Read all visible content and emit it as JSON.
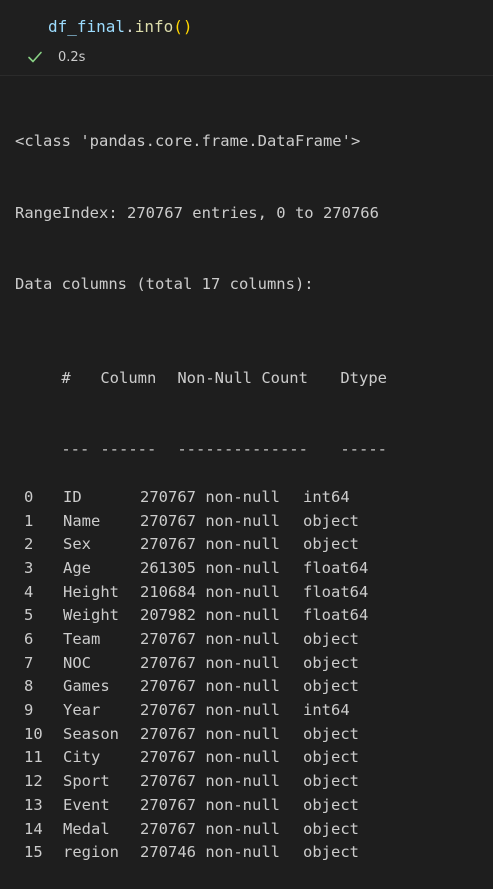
{
  "cell": {
    "code": {
      "variable": "df_final",
      "dot": ".",
      "method": "info",
      "parens": "()"
    },
    "status": {
      "icon": "check-icon",
      "time": "0.2s",
      "success_color": "#89d185"
    }
  },
  "output": {
    "class_line": "<class 'pandas.core.frame.DataFrame'>",
    "range_index": "RangeIndex: 270767 entries, 0 to 270766",
    "data_columns": "Data columns (total 17 columns):",
    "headers": {
      "num": "#",
      "column": "Column",
      "count": "Non-Null Count",
      "dtype": "Dtype"
    },
    "separators": {
      "num": "---",
      "column": "------",
      "count": "--------------",
      "dtype": "-----"
    },
    "rows": [
      {
        "num": "0",
        "column": "ID",
        "count": "270767 non-null",
        "dtype": "int64"
      },
      {
        "num": "1",
        "column": "Name",
        "count": "270767 non-null",
        "dtype": "object"
      },
      {
        "num": "2",
        "column": "Sex",
        "count": "270767 non-null",
        "dtype": "object"
      },
      {
        "num": "3",
        "column": "Age",
        "count": "261305 non-null",
        "dtype": "float64"
      },
      {
        "num": "4",
        "column": "Height",
        "count": "210684 non-null",
        "dtype": "float64"
      },
      {
        "num": "5",
        "column": "Weight",
        "count": "207982 non-null",
        "dtype": "float64"
      },
      {
        "num": "6",
        "column": "Team",
        "count": "270767 non-null",
        "dtype": "object"
      },
      {
        "num": "7",
        "column": "NOC",
        "count": "270767 non-null",
        "dtype": "object"
      },
      {
        "num": "8",
        "column": "Games",
        "count": "270767 non-null",
        "dtype": "object"
      },
      {
        "num": "9",
        "column": "Year",
        "count": "270767 non-null",
        "dtype": "int64"
      },
      {
        "num": "10",
        "column": "Season",
        "count": "270767 non-null",
        "dtype": "object"
      },
      {
        "num": "11",
        "column": "City",
        "count": "270767 non-null",
        "dtype": "object"
      },
      {
        "num": "12",
        "column": "Sport",
        "count": "270767 non-null",
        "dtype": "object"
      },
      {
        "num": "13",
        "column": "Event",
        "count": "270767 non-null",
        "dtype": "object"
      },
      {
        "num": "14",
        "column": "Medal",
        "count": "270767 non-null",
        "dtype": "object"
      },
      {
        "num": "15",
        "column": "region",
        "count": "270746 non-null",
        "dtype": "object"
      }
    ]
  }
}
